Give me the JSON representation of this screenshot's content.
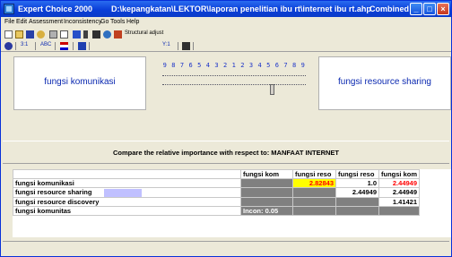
{
  "titlebar": {
    "app_name": "Expert Choice 2000",
    "file_path": "D:\\kepangkatan\\LEKTOR\\laporan penelitian ibu rt\\internet ibu rt.ahp",
    "mode": "Combined"
  },
  "menu": [
    "File",
    "Edit",
    "Assessment",
    "Inconsistency",
    "Go",
    "Tools",
    "Help"
  ],
  "toolbar": {
    "structural_adjust": "Structural adjust",
    "ratio_label": "3:1",
    "abc_label": "ABC",
    "tooltip": "Y:1"
  },
  "comparison": {
    "left": "fungsi komunikasi",
    "right": "fungsi resource sharing",
    "scale": "9 8 7 6 5 4 3 2 1 2 3 4 5 6 7 8 9",
    "value": "4"
  },
  "compare_text": "Compare the relative importance  with respect to: MANFAAT INTERNET",
  "grid": {
    "columns": [
      "fungsi kom",
      "fungsi reso",
      "fungsi reso",
      "fungsi kom"
    ],
    "rows": [
      {
        "label": "fungsi komunikasi",
        "cells": [
          "",
          "2.82843",
          "1.0",
          "2.44949"
        ]
      },
      {
        "label": "fungsi resource sharing",
        "cells": [
          "",
          "",
          "2.44949",
          "2.44949"
        ]
      },
      {
        "label": "fungsi resource discovery",
        "cells": [
          "",
          "",
          "",
          "1.41421"
        ]
      },
      {
        "label": "fungsi komunitas",
        "cells": [
          "Incon: 0.05",
          "",
          "",
          ""
        ]
      }
    ]
  },
  "colors": {
    "title_blue": "#0a3fd8",
    "label_blue": "#0a28b0",
    "highlight": "#ffff00",
    "value_red": "#ff0000"
  }
}
